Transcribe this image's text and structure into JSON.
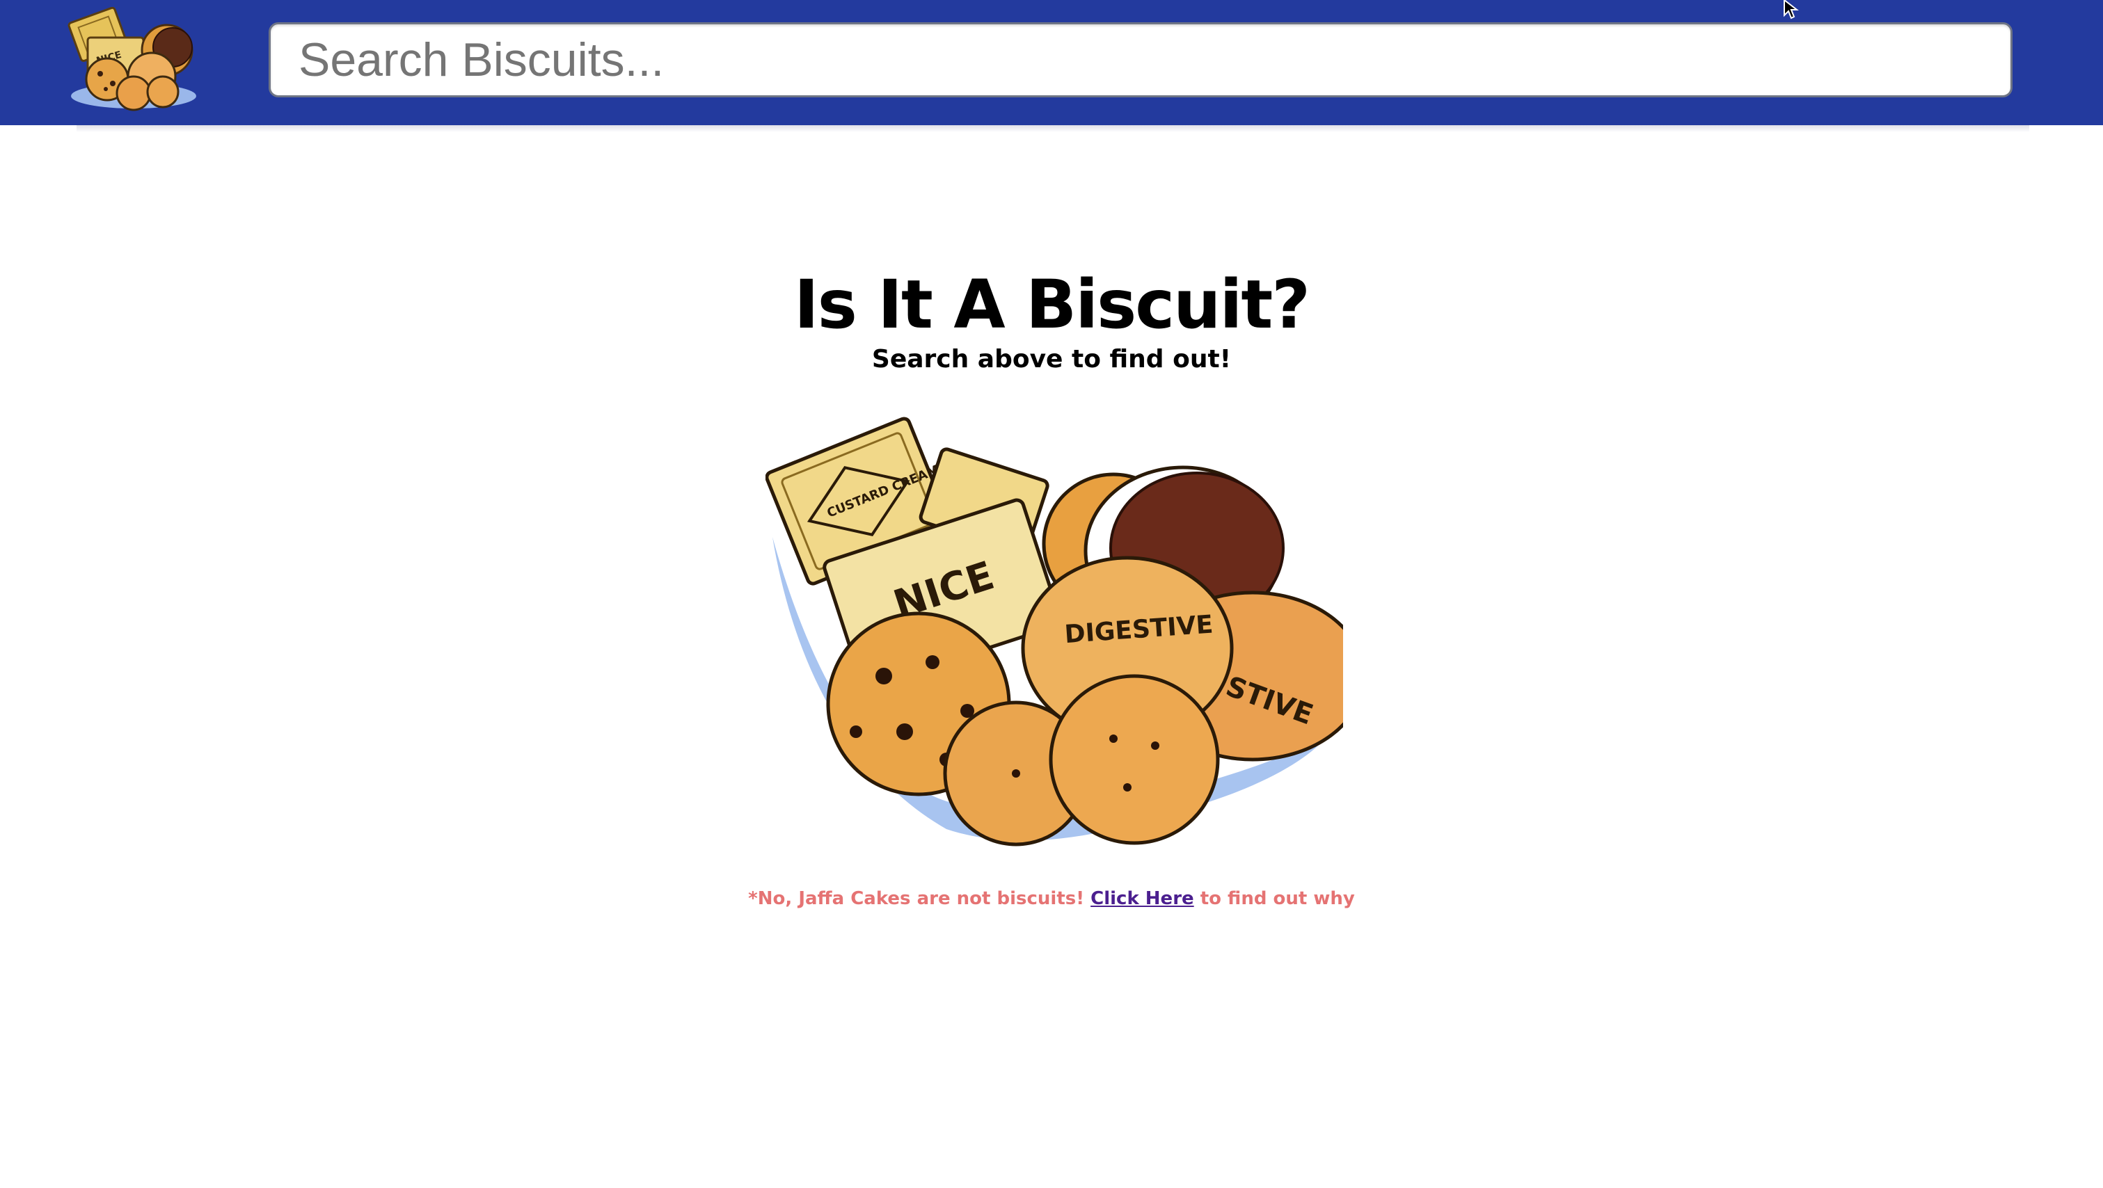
{
  "header": {
    "background_color": "#233a9e",
    "logo_icon": "biscuit-pile-logo-icon",
    "search": {
      "placeholder": "Search Biscuits...",
      "value": ""
    }
  },
  "main": {
    "title": "Is It A Biscuit?",
    "subtitle": "Search above to find out!",
    "hero_image_icon": "biscuit-pile-illustration",
    "hero_labels": {
      "custard": "CUSTARD CREAMS",
      "nice": "NICE",
      "digestive": "DIGESTIVE",
      "digestive_partial": "STIVE"
    },
    "footnote": {
      "prefix": "*No, Jaffa Cakes are not biscuits! ",
      "link": "Click Here",
      "suffix": " to find out why",
      "text_color": "#e57373",
      "link_color": "#4b1f8f"
    }
  }
}
